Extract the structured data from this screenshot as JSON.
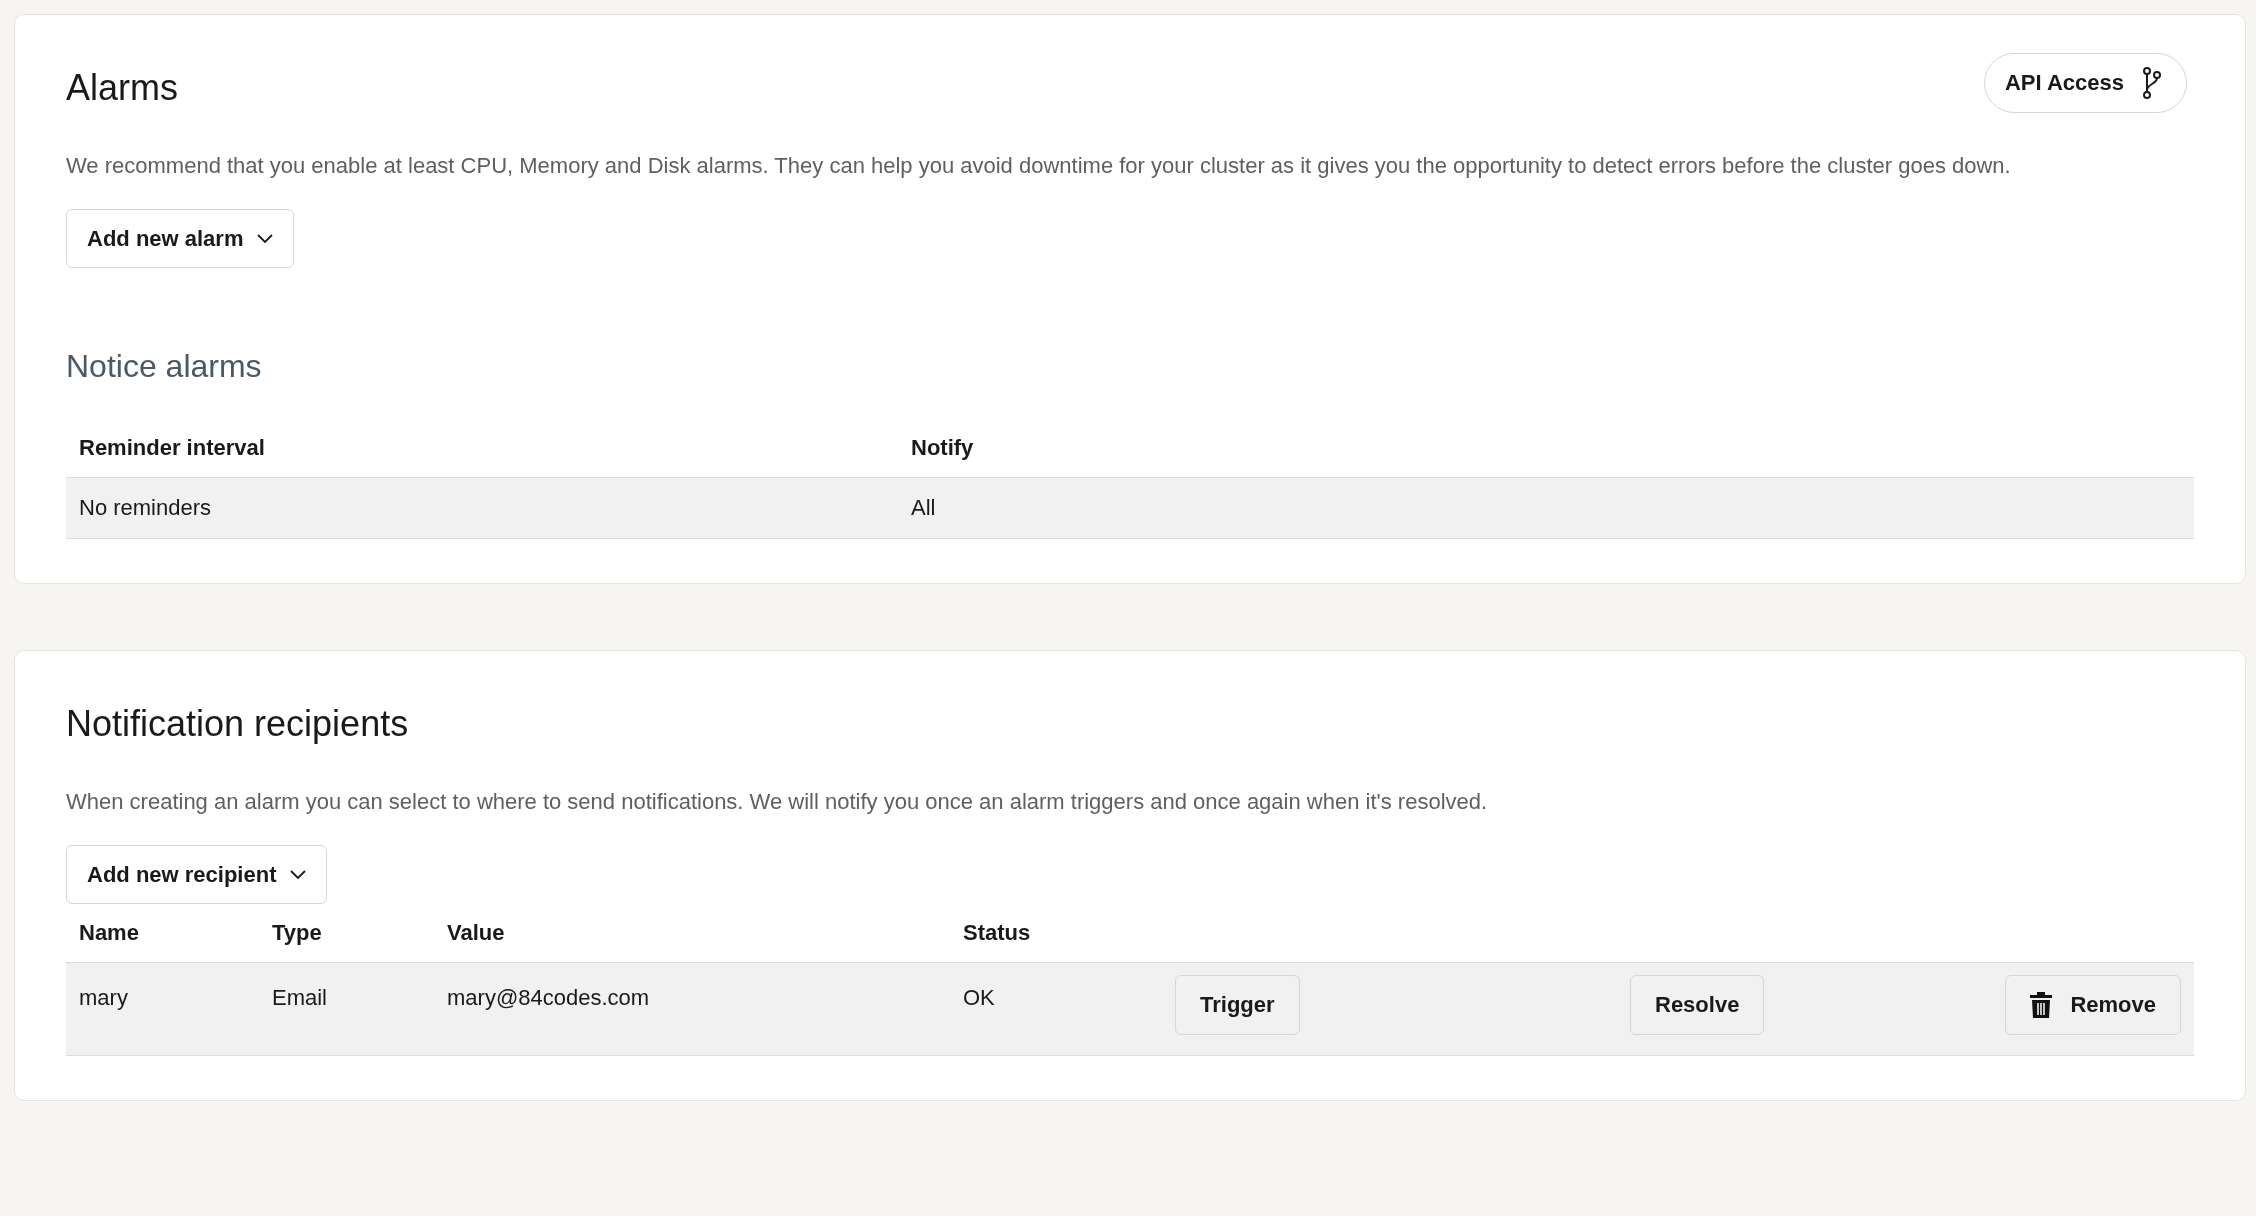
{
  "alarms": {
    "title": "Alarms",
    "api_button": "API Access",
    "description": "We recommend that you enable at least CPU, Memory and Disk alarms. They can help you avoid downtime for your cluster as it gives you the opportunity to detect errors before the cluster goes down.",
    "add_button": "Add new alarm"
  },
  "notice_alarms": {
    "title": "Notice alarms",
    "columns": [
      "Reminder interval",
      "Notify"
    ],
    "rows": [
      [
        "No reminders",
        "All"
      ]
    ]
  },
  "recipients": {
    "title": "Notification recipients",
    "description": "When creating an alarm you can select to where to send notifications. We will notify you once an alarm triggers and once again when it's resolved.",
    "add_button": "Add new recipient",
    "columns": [
      "Name",
      "Type",
      "Value",
      "Status"
    ],
    "rows": [
      {
        "name": "mary",
        "type": "Email",
        "value": "mary@84codes.com",
        "status": "OK",
        "actions": [
          {
            "kind": "trigger",
            "label": "Trigger"
          },
          {
            "kind": "resolve",
            "label": "Resolve"
          },
          {
            "kind": "remove",
            "label": "Remove"
          }
        ]
      }
    ]
  }
}
